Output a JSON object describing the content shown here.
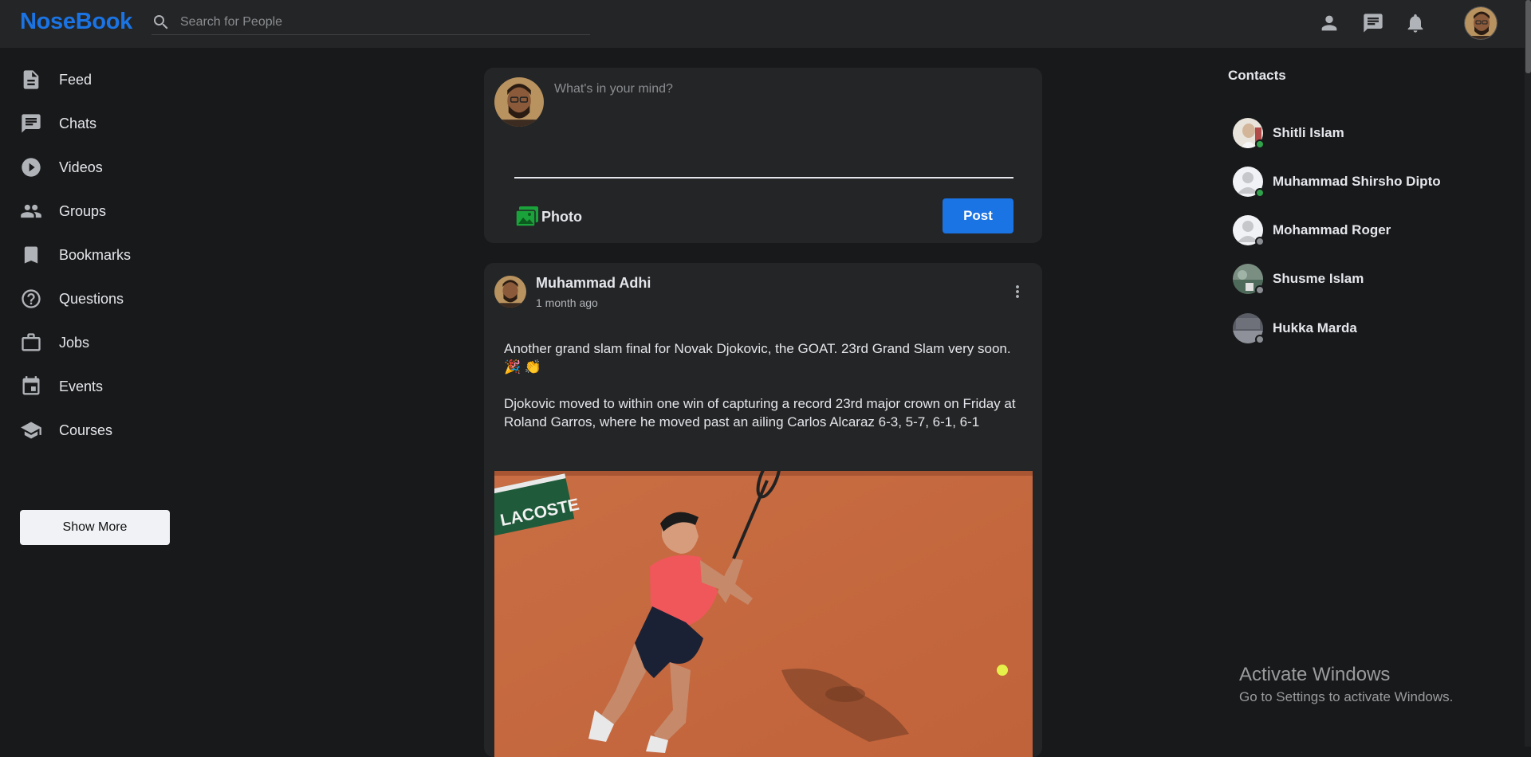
{
  "header": {
    "logo": "NoseBook",
    "search_placeholder": "Search for People",
    "icons": [
      "person-icon",
      "chat-icon",
      "bell-icon"
    ]
  },
  "sidebar": {
    "items": [
      {
        "label": "Feed",
        "icon": "feed-icon"
      },
      {
        "label": "Chats",
        "icon": "chat-icon"
      },
      {
        "label": "Videos",
        "icon": "play-icon"
      },
      {
        "label": "Groups",
        "icon": "group-icon"
      },
      {
        "label": "Bookmarks",
        "icon": "bookmark-icon"
      },
      {
        "label": "Questions",
        "icon": "question-icon"
      },
      {
        "label": "Jobs",
        "icon": "briefcase-icon"
      },
      {
        "label": "Events",
        "icon": "calendar-icon"
      },
      {
        "label": "Courses",
        "icon": "school-icon"
      }
    ],
    "show_more": "Show More"
  },
  "composer": {
    "placeholder": "What's in your mind?",
    "photo_label": "Photo",
    "post_label": "Post"
  },
  "post": {
    "author": "Muhammad Adhi",
    "time": "1 month ago",
    "paragraph1": "Another grand slam final for Novak Djokovic, the GOAT. 23rd Grand Slam very soon. 🎉 👏",
    "paragraph2": "Djokovic moved to within one win of capturing a record 23rd major crown on Friday at Roland Garros, where he moved past an ailing Carlos Alcaraz 6-3, 5-7, 6-1, 6-1",
    "image_sign": "LACOSTE"
  },
  "contacts": {
    "title": "Contacts",
    "items": [
      {
        "name": "Shitli Islam",
        "status": "online"
      },
      {
        "name": "Muhammad Shirsho Dipto",
        "status": "online"
      },
      {
        "name": "Mohammad Roger",
        "status": "offline"
      },
      {
        "name": "Shusme Islam",
        "status": "offline"
      },
      {
        "name": "Hukka Marda",
        "status": "offline"
      }
    ]
  },
  "watermark": {
    "title": "Activate Windows",
    "subtitle": "Go to Settings to activate Windows."
  },
  "colors": {
    "accent": "#1b74e4",
    "online": "#31a24c",
    "offline": "#8a8d91",
    "photo_icon": "#1aa33a"
  }
}
